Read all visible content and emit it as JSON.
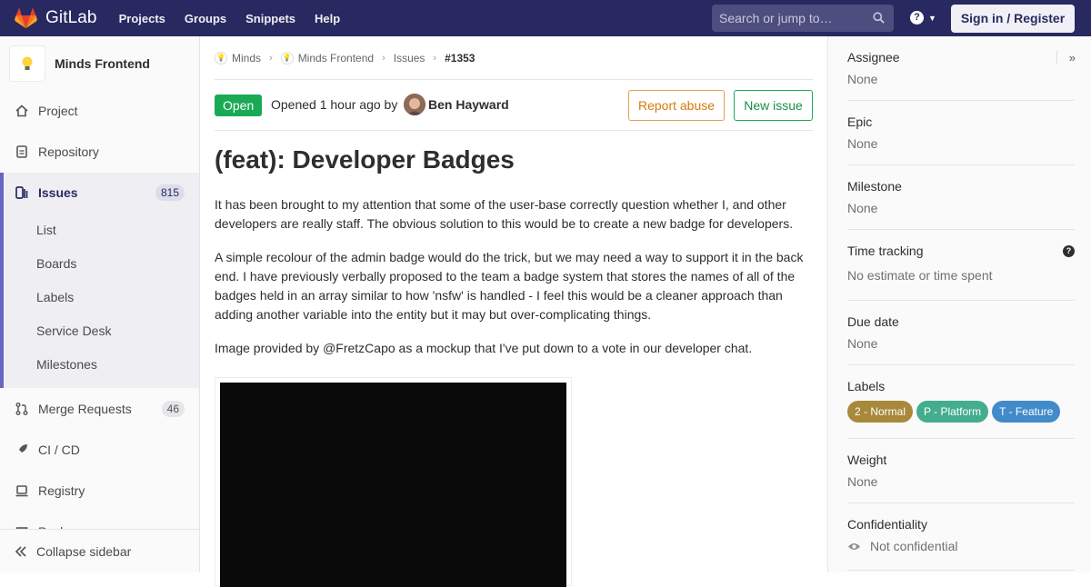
{
  "navbar": {
    "brand": "GitLab",
    "links": [
      "Projects",
      "Groups",
      "Snippets",
      "Help"
    ],
    "search_placeholder": "Search or jump to…",
    "signin_label": "Sign in / Register"
  },
  "sidebar": {
    "project_name": "Minds Frontend",
    "items": [
      {
        "label": "Project",
        "icon": "home-icon"
      },
      {
        "label": "Repository",
        "icon": "doc-icon"
      },
      {
        "label": "Issues",
        "count": "815",
        "icon": "issues-icon"
      },
      {
        "label": "Merge Requests",
        "count": "46",
        "icon": "merge-icon"
      },
      {
        "label": "CI / CD",
        "icon": "rocket-icon"
      },
      {
        "label": "Registry",
        "icon": "registry-icon"
      },
      {
        "label": "Packages",
        "icon": "package-icon"
      }
    ],
    "sub_items": [
      "List",
      "Boards",
      "Labels",
      "Service Desk",
      "Milestones"
    ],
    "collapse_label": "Collapse sidebar"
  },
  "breadcrumb": {
    "items": [
      "Minds",
      "Minds Frontend",
      "Issues",
      "#1353"
    ]
  },
  "issue": {
    "status": "Open",
    "opened_text": "Opened 1 hour ago by",
    "author": "Ben Hayward",
    "report_label": "Report abuse",
    "new_label": "New issue",
    "title": "(feat): Developer Badges",
    "paragraphs": [
      "It has been brought to my attention that some of the user-base correctly question whether I, and other developers are really staff. The obvious solution to this would be to create a new badge for developers.",
      "A simple recolour of the admin badge would do the trick, but we may need a way to support it in the back end. I have previously verbally proposed to the team a badge system that stores the names of all of the badges held in an array similar to how 'nsfw' is handled - I feel this would be a cleaner approach than adding another variable into the entity but it may but over-complicating things.",
      "Image provided by @FretzCapo as a mockup that I've put down to a vote in our developer chat."
    ]
  },
  "right_sidebar": {
    "assignee": {
      "title": "Assignee",
      "value": "None"
    },
    "epic": {
      "title": "Epic",
      "value": "None"
    },
    "milestone": {
      "title": "Milestone",
      "value": "None"
    },
    "time_tracking": {
      "title": "Time tracking",
      "value": "No estimate or time spent"
    },
    "due_date": {
      "title": "Due date",
      "value": "None"
    },
    "labels": {
      "title": "Labels",
      "items": [
        {
          "text": "2 - Normal",
          "color": "#a8883a"
        },
        {
          "text": "P - Platform",
          "color": "#44ad8e"
        },
        {
          "text": "T - Feature",
          "color": "#428bca"
        }
      ]
    },
    "weight": {
      "title": "Weight",
      "value": "None"
    },
    "confidentiality": {
      "title": "Confidentiality",
      "value": "Not confidential"
    }
  }
}
